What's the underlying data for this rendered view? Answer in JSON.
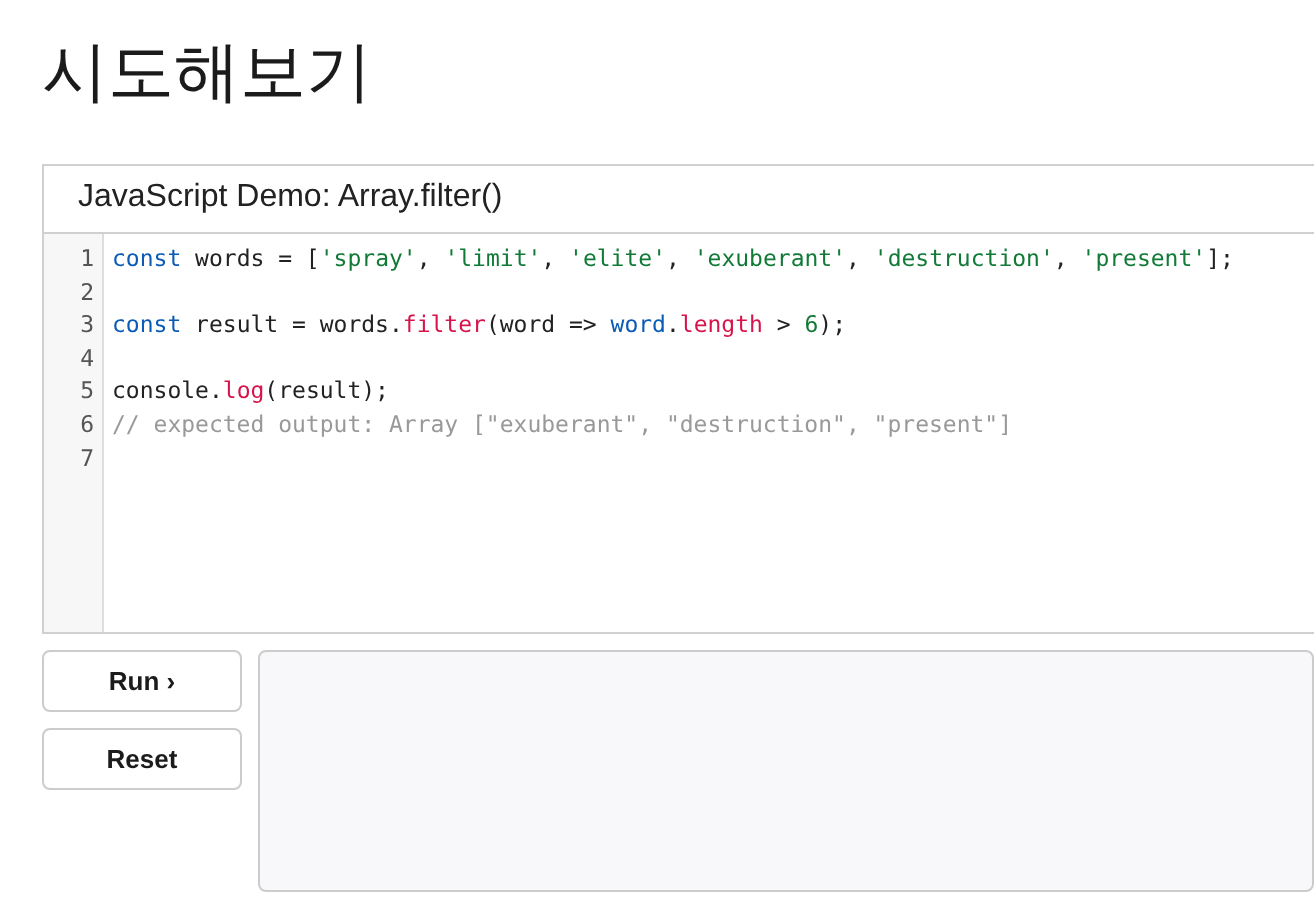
{
  "page_title": "시도해보기",
  "demo": {
    "title": "JavaScript Demo: Array.filter()",
    "lines": [
      {
        "number": "1",
        "tokens": [
          {
            "kind": "keyword",
            "text": "const"
          },
          {
            "kind": "plain",
            "text": " words = ["
          },
          {
            "kind": "string",
            "text": "'spray'"
          },
          {
            "kind": "plain",
            "text": ", "
          },
          {
            "kind": "string",
            "text": "'limit'"
          },
          {
            "kind": "plain",
            "text": ", "
          },
          {
            "kind": "string",
            "text": "'elite'"
          },
          {
            "kind": "plain",
            "text": ", "
          },
          {
            "kind": "string",
            "text": "'exuberant'"
          },
          {
            "kind": "plain",
            "text": ", "
          },
          {
            "kind": "string",
            "text": "'destruction'"
          },
          {
            "kind": "plain",
            "text": ", "
          },
          {
            "kind": "string",
            "text": "'present'"
          },
          {
            "kind": "plain",
            "text": "];"
          }
        ]
      },
      {
        "number": "2"
      },
      {
        "number": "3",
        "tokens": [
          {
            "kind": "keyword",
            "text": "const"
          },
          {
            "kind": "plain",
            "text": " result = words."
          },
          {
            "kind": "property",
            "text": "filter"
          },
          {
            "kind": "plain",
            "text": "(word => "
          },
          {
            "kind": "keyword",
            "text": "word"
          },
          {
            "kind": "plain",
            "text": "."
          },
          {
            "kind": "property",
            "text": "length"
          },
          {
            "kind": "plain",
            "text": " > "
          },
          {
            "kind": "number",
            "text": "6"
          },
          {
            "kind": "plain",
            "text": ");"
          }
        ]
      },
      {
        "number": "4"
      },
      {
        "number": "5",
        "tokens": [
          {
            "kind": "plain",
            "text": "console."
          },
          {
            "kind": "property",
            "text": "log"
          },
          {
            "kind": "plain",
            "text": "(result);"
          }
        ]
      },
      {
        "number": "6",
        "tokens": [
          {
            "kind": "comment",
            "text": "// expected output: Array [\"exuberant\", \"destruction\", \"present\"]"
          }
        ]
      },
      {
        "number": "7"
      }
    ],
    "buttons": [
      "Run ›",
      "Reset"
    ]
  }
}
